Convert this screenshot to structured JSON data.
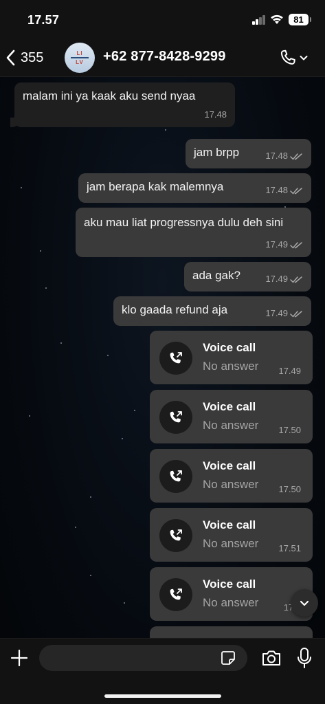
{
  "status": {
    "time": "17.57",
    "battery": "81"
  },
  "header": {
    "back_count": "355",
    "contact_name": "+62 877-8428-9299",
    "avatar_line_top": "LI",
    "avatar_line_bottom": "LV"
  },
  "messages": [
    {
      "direction": "in",
      "text": "malam ini ya kaak aku send nyaa",
      "time": "17.48"
    },
    {
      "direction": "out",
      "text": "jam brpp",
      "time": "17.48"
    },
    {
      "direction": "out",
      "text": "jam berapa kak malemnya",
      "time": "17.48"
    },
    {
      "direction": "out",
      "text": "aku mau liat progressnya dulu deh sini",
      "time": "17.49"
    },
    {
      "direction": "out",
      "text": "ada gak?",
      "time": "17.49"
    },
    {
      "direction": "out",
      "text": "klo gaada refund aja",
      "time": "17.49"
    }
  ],
  "calls": [
    {
      "title": "Voice call",
      "status": "No answer",
      "time": "17.49"
    },
    {
      "title": "Voice call",
      "status": "No answer",
      "time": "17.50"
    },
    {
      "title": "Voice call",
      "status": "No answer",
      "time": "17.50"
    },
    {
      "title": "Voice call",
      "status": "No answer",
      "time": "17.51"
    },
    {
      "title": "Voice call",
      "status": "No answer",
      "time": "17.5"
    }
  ],
  "composer": {
    "placeholder": ""
  },
  "icons": {
    "back": "chevron-left-icon",
    "call": "phone-icon",
    "read_receipt": "double-check-icon",
    "outgoing_call": "outgoing-call-icon",
    "scroll_down": "chevron-down-icon",
    "plus": "plus-icon",
    "sticker": "sticker-icon",
    "camera": "camera-icon",
    "mic": "microphone-icon"
  },
  "colors": {
    "incoming_bubble": "#1f1f1f",
    "outgoing_bubble": "#3a3a3a",
    "meta_text": "#a8a8a8"
  }
}
